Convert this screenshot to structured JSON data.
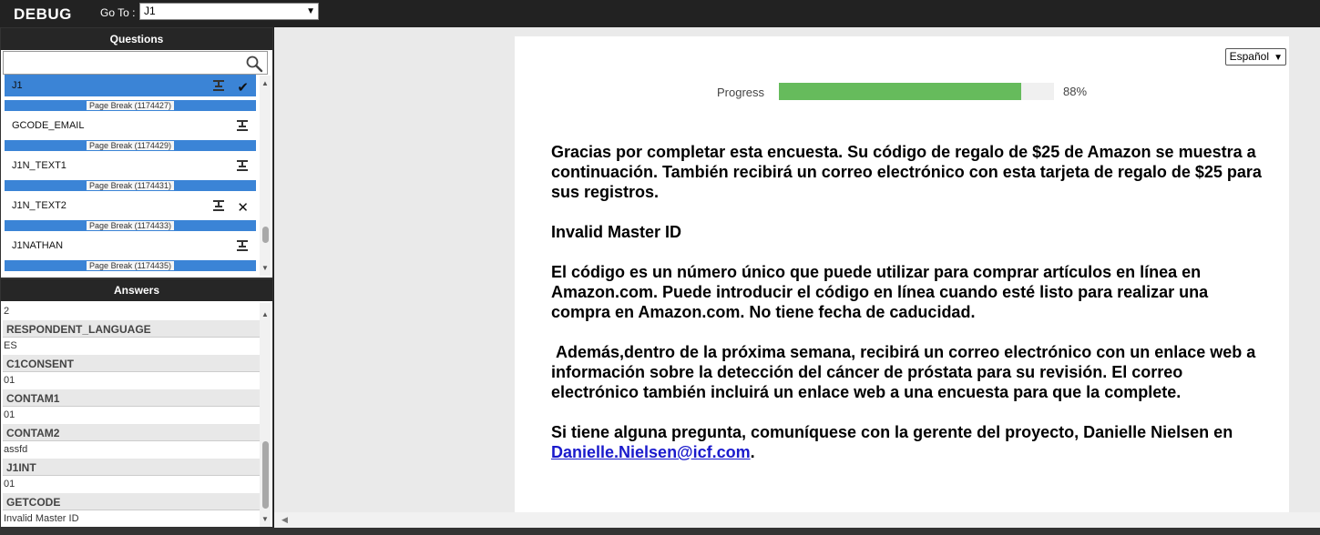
{
  "topbar": {
    "brand": "DEBUG",
    "goto_label": "Go To :",
    "goto_selected": "J1"
  },
  "questions": {
    "header": "Questions",
    "items": [
      {
        "label": "J1",
        "selected": true,
        "status": "check"
      },
      {
        "pagebreak": "Page Break (1174427)"
      },
      {
        "label": "GCODE_EMAIL"
      },
      {
        "pagebreak": "Page Break (1174429)"
      },
      {
        "label": "J1N_TEXT1"
      },
      {
        "pagebreak": "Page Break (1174431)"
      },
      {
        "label": "J1N_TEXT2",
        "status": "cross"
      },
      {
        "pagebreak": "Page Break (1174433)"
      },
      {
        "label": "J1NATHAN"
      },
      {
        "pagebreak": "Page Break (1174435)"
      }
    ],
    "icons": {
      "search": "search-icon",
      "flow": "branch-flow-icon",
      "check": "check-icon",
      "cross": "close-icon"
    }
  },
  "answers": {
    "header": "Answers",
    "top_value": "2",
    "items": [
      {
        "name": "RESPONDENT_LANGUAGE",
        "value": "ES"
      },
      {
        "name": "C1CONSENT",
        "value": "01"
      },
      {
        "name": "CONTAM1",
        "value": "01"
      },
      {
        "name": "CONTAM2",
        "value": "assfd"
      },
      {
        "name": "J1INT",
        "value": "01"
      },
      {
        "name": "GETCODE",
        "value": "Invalid Master ID"
      }
    ]
  },
  "survey": {
    "language": "Español",
    "progress_label": "Progress",
    "progress_value": 88,
    "progress_text": "88%",
    "paragraphs": {
      "p1": "Gracias por completar esta encuesta. Su código de regalo de $25 de Amazon se muestra a continuación. También recibirá un correo electrónico con esta tarjeta de regalo de $25 para sus registros.",
      "p2": "Invalid Master ID",
      "p3": "El código es un número único que puede utilizar para comprar artículos en línea en Amazon.com. Puede introducir el código en línea cuando esté listo para realizar una compra en Amazon.com. No tiene fecha de caducidad.",
      "p4": " Además,dentro de la próxima semana, recibirá un correo electrónico con un enlace web a información sobre la detección del cáncer de próstata para su revisión. El correo electrónico también incluirá un enlace web a una encuesta para que la complete.",
      "p5_prefix": "Si tiene alguna pregunta, comuníquese con la gerente del proyecto, Danielle Nielsen en ",
      "p5_link": "Danielle.Nielsen@icf.com",
      "p5_suffix": "."
    }
  },
  "colors": {
    "accent": "#3b84d6",
    "progress": "#66bb5c",
    "header": "#262626"
  }
}
